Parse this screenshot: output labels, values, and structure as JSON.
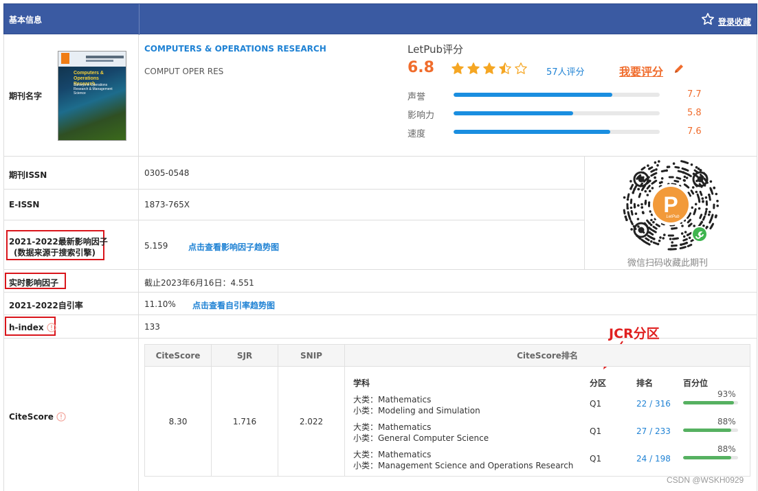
{
  "header": {
    "title": "基本信息",
    "favorite_label": "登录收藏"
  },
  "journal": {
    "label": "期刊名字",
    "full_name": "COMPUTERS & OPERATIONS RESEARCH",
    "abbr_name": "COMPUT OPER RES",
    "cover_title": "Computers & Operations Research",
    "cover_subtitle": "Surveys in Operations Research & Management Science"
  },
  "letpub": {
    "title": "LetPub评分",
    "score": "6.8",
    "stars": 3.5,
    "reviews": "57人评分",
    "rate_me": "我要评分",
    "metrics": [
      {
        "name": "声誉",
        "value": "7.7",
        "fraction": 0.77
      },
      {
        "name": "影响力",
        "value": "5.8",
        "fraction": 0.58
      },
      {
        "name": "速度",
        "value": "7.6",
        "fraction": 0.76
      }
    ],
    "accent": "#f06c2c",
    "bar_color": "#1a8ee0"
  },
  "rows": {
    "issn_label": "期刊ISSN",
    "issn": "0305-0548",
    "eissn_label": "E-ISSN",
    "eissn": "1873-765X",
    "if_label_1": "2021-2022最新影响因子",
    "if_label_2": "(数据来源于搜索引擎)",
    "if_value": "5.159",
    "if_link": "点击查看影响因子趋势图",
    "rt_label": "实时影响因子",
    "rt_value": "截止2023年6月16日：4.551",
    "self_label": "2021-2022自引率",
    "self_value": "11.10%",
    "self_link": "点击查看自引率趋势图",
    "h_label": "h-index",
    "h_value": "133",
    "cs_label": "CiteScore"
  },
  "qr": {
    "caption": "微信扫码收藏此期刊",
    "logo_text": "LetPub"
  },
  "annotation": {
    "jcr": "JCR分区"
  },
  "citescore": {
    "headers": [
      "CiteScore",
      "SJR",
      "SNIP",
      "CiteScore排名"
    ],
    "values": [
      "8.30",
      "1.716",
      "2.022"
    ],
    "rank_headers": [
      "学科",
      "分区",
      "排名",
      "百分位"
    ],
    "entries": [
      {
        "major": "大类：Mathematics",
        "minor": "小类：Modeling and Simulation",
        "quartile": "Q1",
        "rank": "22 / 316",
        "percentile": "93%",
        "fraction": 0.93
      },
      {
        "major": "大类：Mathematics",
        "minor": "小类：General Computer Science",
        "quartile": "Q1",
        "rank": "27 / 233",
        "percentile": "88%",
        "fraction": 0.88
      },
      {
        "major": "大类：Mathematics",
        "minor": "小类：Management Science and Operations Research",
        "quartile": "Q1",
        "rank": "24 / 198",
        "percentile": "88%",
        "fraction": 0.88
      }
    ]
  },
  "watermark": "CSDN @WSKH0929"
}
